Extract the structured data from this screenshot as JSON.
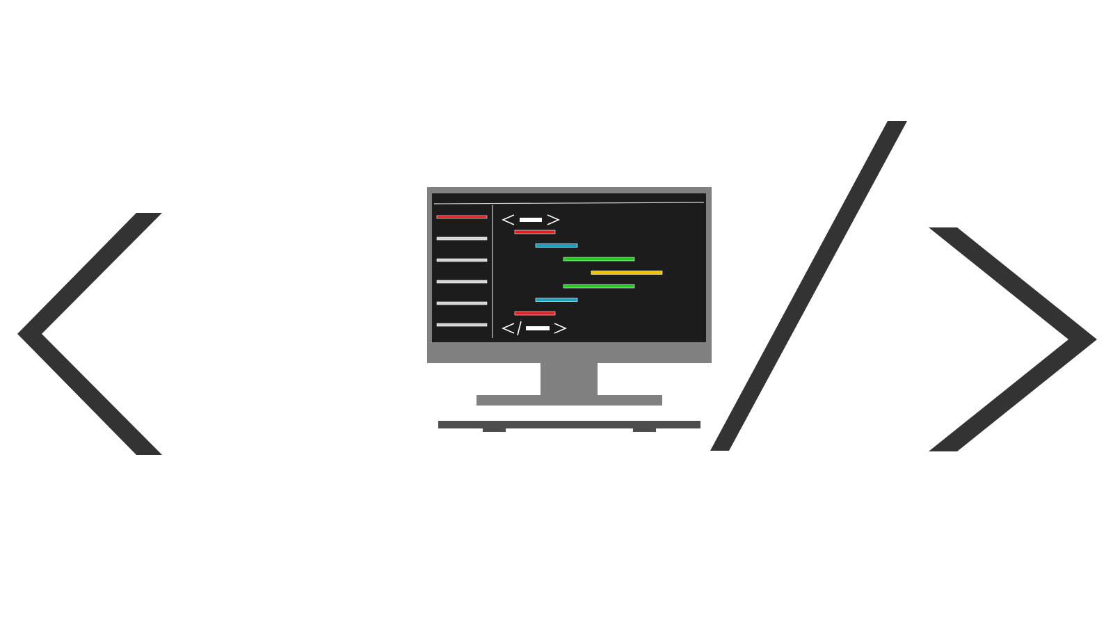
{
  "colors": {
    "background": "#ffffff",
    "glyph": "#333333",
    "monitor_frame": "#808080",
    "screen": "#1c1c1c",
    "keyboard": "#4d4d4d",
    "sidebar_accent": "#e02020",
    "sidebar_line": "#d4d4d4",
    "code_red": "#e02020",
    "code_cyan": "#17a2c4",
    "code_green": "#22cc22",
    "code_yellow": "#f2c200",
    "tag_white": "#ffffff"
  },
  "glyphs": {
    "left": "left-angle-bracket",
    "slash": "forward-slash",
    "right": "right-angle-bracket"
  },
  "icon": "computer-monitor-icon",
  "sidebar_items": [
    {
      "color": "sidebar_accent"
    },
    {
      "color": "sidebar_line"
    },
    {
      "color": "sidebar_line"
    },
    {
      "color": "sidebar_line"
    },
    {
      "color": "sidebar_line"
    },
    {
      "color": "sidebar_line"
    }
  ],
  "code_lines": [
    {
      "color": "code_red",
      "indent": 1,
      "length": 2
    },
    {
      "color": "code_cyan",
      "indent": 2,
      "length": 3
    },
    {
      "color": "code_green",
      "indent": 3,
      "length": 4
    },
    {
      "color": "code_yellow",
      "indent": 4,
      "length": 4
    },
    {
      "color": "code_green",
      "indent": 3,
      "length": 4
    },
    {
      "color": "code_cyan",
      "indent": 2,
      "length": 3
    },
    {
      "color": "code_red",
      "indent": 1,
      "length": 2
    }
  ]
}
